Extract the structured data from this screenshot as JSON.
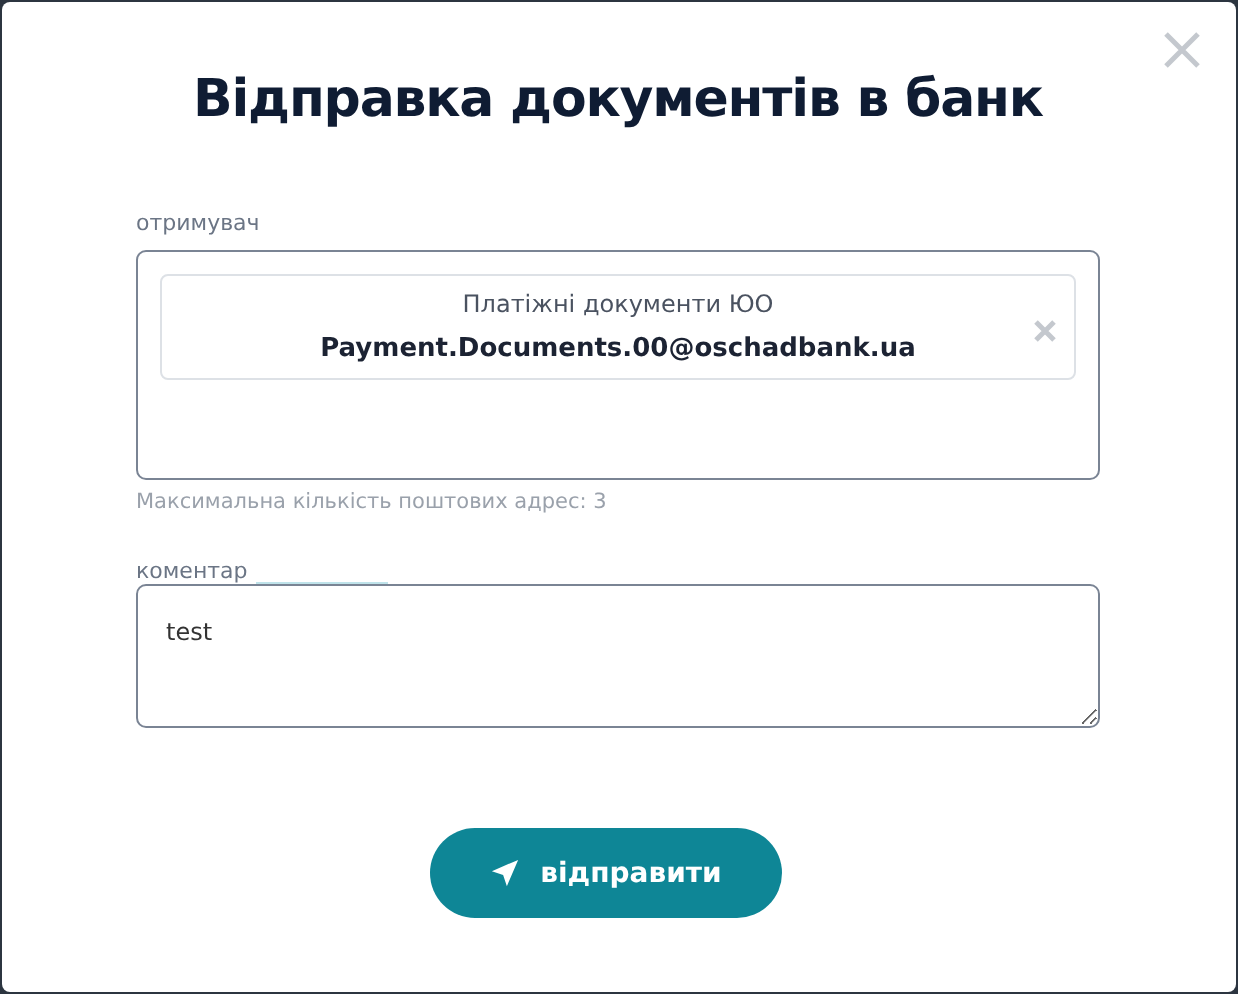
{
  "dialog": {
    "title": "Відправка документів в банк"
  },
  "recipient": {
    "label": "отримувач",
    "chips": [
      {
        "name": "Платіжні документи ЮО",
        "email": "Payment.Documents.00@oschadbank.ua"
      }
    ],
    "hint": "Максимальна кількість поштових адрес: 3"
  },
  "comment": {
    "label": "коментар",
    "value": "test"
  },
  "submit_button": {
    "label": "відправити"
  }
}
